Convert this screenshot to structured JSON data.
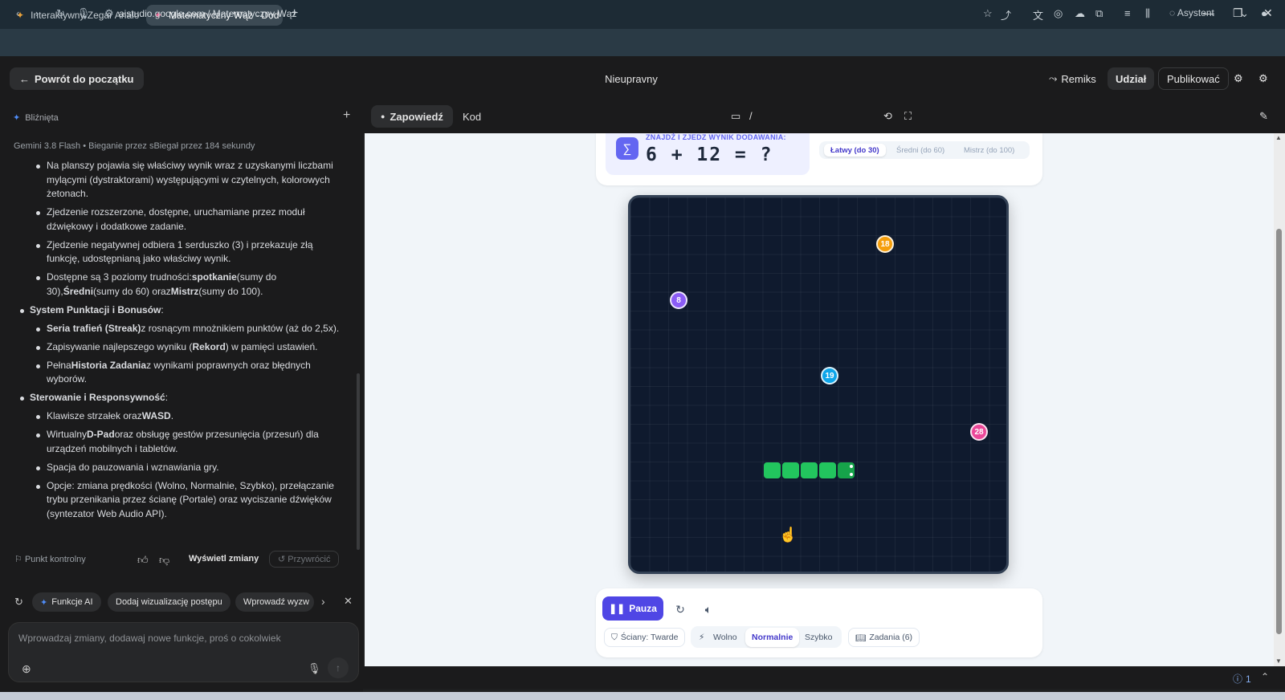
{
  "browser": {
    "tabs": [
      {
        "label": "Interaktywny Zegar Analo"
      },
      {
        "label": "Matematyczny Wąż - Dod"
      }
    ],
    "new_tab": "+",
    "url_host": "aistudio.google.com",
    "url_sep": "/",
    "url_path": "Matematyczny Wąż",
    "assistant_label": "Asystent"
  },
  "app": {
    "back_label": "Powrót do początku",
    "title": "Nieupravny",
    "remix_label": "Remiks",
    "share_label": "Udział",
    "publish_label": "Publikować"
  },
  "chat": {
    "header_label": "Bliźnięta",
    "model": "Gemini 3.8 Flash",
    "dot": "•",
    "run_info": "Bieganie przez sBiegał przez 184 sekundy",
    "items": [
      {
        "text": "Na planszy pojawia się właściwy wynik wraz z uzyskanymi liczbami mylącymi (dystraktorami) występującymi w czytelnych, kolorowych żetonach."
      },
      {
        "text": "Zjedzenie rozszerzone, dostępne, uruchamiane przez moduł dźwiękowy i dodatkowe zadanie."
      },
      {
        "text": "Zjedzenie negatywnej odbiera 1 serduszko (3) i przekazuje złą funkcję, udostępnianą jako właściwy wynik."
      },
      {
        "a": "Dostępne są 3 poziomy trudności:",
        "b": "spotkanie",
        "c": "(sumy do 30),",
        "d": "Średni",
        "e": "(sumy do 60) oraz",
        "f": "Mistrz",
        "g": "(sumy do 100)."
      }
    ],
    "section2": "System Punktacji i Bonusów",
    "colon": ":",
    "items2": [
      {
        "b": "Seria trafień (Streak)",
        "t": "z rosnącym mnożnikiem punktów (aż do 2,5x)."
      },
      {
        "t1": "Zapisywanie najlepszego wyniku (",
        "b": "Rekord",
        "t2": ") w pamięci ustawień."
      },
      {
        "t1": "Pełna",
        "b": "Historia Zadania",
        "t2": "z wynikami poprawnych oraz błędnych wyborów."
      }
    ],
    "section3": "Sterowanie i Responsywność",
    "items3": [
      {
        "t1": "Klawisze strzałek oraz",
        "b": "WASD",
        "t2": "."
      },
      {
        "t1": "Wirtualny",
        "b": "D-Pad",
        "t2": "oraz obsługę gestów przesunięcia (przesuń) dla urządzeń mobilnych i tabletów."
      },
      {
        "t1": "Spacja do pauzowania i wznawiania gry."
      },
      {
        "t1": "Opcje: zmiana prędkości (Wolno, Normalnie, Szybko), przełączanie trybu przenikania przez ścianę (Portale) oraz wyciszanie dźwięków (syntezator Web Audio API)."
      }
    ],
    "checkpoint_label": "Punkt kontrolny",
    "view_changes_label": "Wyświetl zmiany",
    "restore_label": "Przywrócić",
    "suggestions": [
      "Funkcje AI",
      "Dodaj wizualizację postępu",
      "Wprowadź wyzw"
    ],
    "input_placeholder": "Wprowadzaj zmiany, dodawaj nowe funkcje, proś o cokolwiek"
  },
  "preview_bar": {
    "tab_preview": "Zapowiedź",
    "tab_code": "Kod",
    "slash": "/"
  },
  "game": {
    "question_label": "ZNAJDŹ I ZJEDZ WYNIK DODAWANIA:",
    "expression": "6 + 12 = ?",
    "levels": [
      "Łatwy (do 30)",
      "Średni (do 60)",
      "Mistrz (do 100)"
    ],
    "tokens": [
      {
        "value": "18",
        "color": "#f59e0b"
      },
      {
        "value": "8",
        "color": "#8b5cf6"
      },
      {
        "value": "19",
        "color": "#0ea5e9"
      },
      {
        "value": "28",
        "color": "#ec4899"
      }
    ],
    "snake_color": "#22c55e",
    "pause_label": "Pauza",
    "walls_label": "Ściany: Twarde",
    "speeds": [
      "Wolno",
      "Normalnie",
      "Szybko"
    ],
    "tasks_label": "Zadania (6)"
  },
  "status": {
    "issues": "1"
  }
}
